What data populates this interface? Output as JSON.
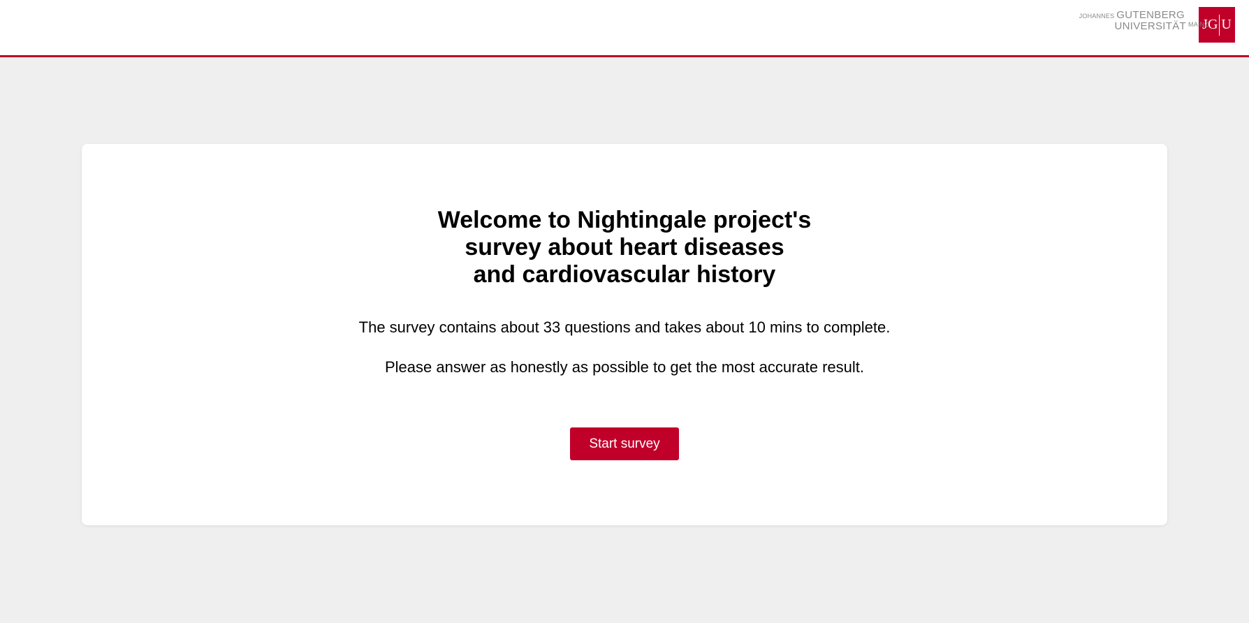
{
  "header": {
    "logo": {
      "line1_small": "JOHANNES",
      "line1_big": "GUTENBERG",
      "line2_big": "UNIVERSITÄT",
      "line2_small": "MAINZ",
      "mark_left": "JG",
      "mark_right": "U"
    },
    "accent_color": "#c1002a"
  },
  "welcome": {
    "title_lines": [
      "Welcome to Nightingale project's",
      "survey about heart diseases",
      "and cardiovascular history"
    ],
    "info": "The survey contains about 33 questions and takes about 10 mins to complete.",
    "instruction": "Please answer as honestly as possible to get the most accurate result.",
    "start_button": "Start survey"
  }
}
